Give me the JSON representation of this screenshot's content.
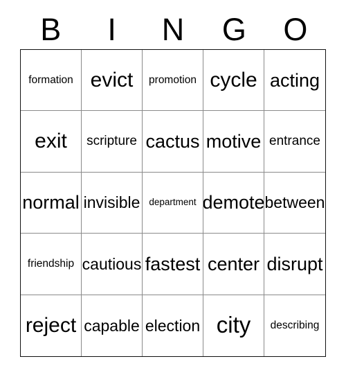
{
  "card": {
    "title": "BINGO Card",
    "headers": [
      "B",
      "I",
      "N",
      "G",
      "O"
    ],
    "colors": {
      "background": "#ffffff",
      "text": "#000000",
      "outer_border": "#111111",
      "inner_grid_line": "#8a8a8a"
    },
    "grid": {
      "columns": 5,
      "rows": 5,
      "cells": [
        [
          {
            "text": "formation",
            "size": "xs"
          },
          {
            "text": "evict",
            "size": "xl"
          },
          {
            "text": "promotion",
            "size": "xs"
          },
          {
            "text": "cycle",
            "size": "xl"
          },
          {
            "text": "acting",
            "size": "l"
          }
        ],
        [
          {
            "text": "exit",
            "size": "xl"
          },
          {
            "text": "scripture",
            "size": "s"
          },
          {
            "text": "cactus",
            "size": "l"
          },
          {
            "text": "motive",
            "size": "l"
          },
          {
            "text": "entrance",
            "size": "s"
          }
        ],
        [
          {
            "text": "normal",
            "size": "l"
          },
          {
            "text": "invisible",
            "size": "m"
          },
          {
            "text": "department",
            "size": "xxs"
          },
          {
            "text": "demote",
            "size": "l"
          },
          {
            "text": "between",
            "size": "m"
          }
        ],
        [
          {
            "text": "friendship",
            "size": "xs"
          },
          {
            "text": "cautious",
            "size": "m"
          },
          {
            "text": "fastest",
            "size": "l"
          },
          {
            "text": "center",
            "size": "l"
          },
          {
            "text": "disrupt",
            "size": "l"
          }
        ],
        [
          {
            "text": "reject",
            "size": "xl"
          },
          {
            "text": "capable",
            "size": "m"
          },
          {
            "text": "election",
            "size": "m"
          },
          {
            "text": "city",
            "size": "xxl"
          },
          {
            "text": "describing",
            "size": "xs"
          }
        ]
      ]
    }
  }
}
